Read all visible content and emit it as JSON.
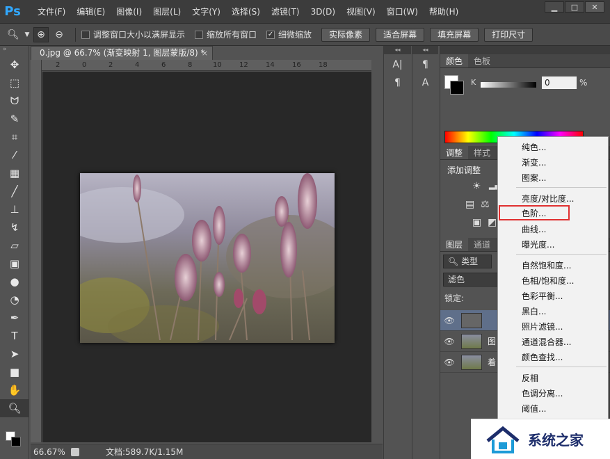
{
  "app": {
    "logo": "Ps"
  },
  "menu": [
    "文件(F)",
    "编辑(E)",
    "图像(I)",
    "图层(L)",
    "文字(Y)",
    "选择(S)",
    "滤镜(T)",
    "3D(D)",
    "视图(V)",
    "窗口(W)",
    "帮助(H)"
  ],
  "window_controls": {
    "minimize": "▁",
    "maximize": "□",
    "close": "✕"
  },
  "options": {
    "resize_windows": "调整窗口大小以满屏显示",
    "zoom_all": "缩放所有窗口",
    "scrubby_zoom": "细微缩放",
    "actual_pixels": "实际像素",
    "fit_screen": "适合屏幕",
    "fill_screen": "填充屏幕",
    "print_size": "打印尺寸",
    "scrubby_checked": "✓"
  },
  "document": {
    "tab_title": "0.jpg @ 66.7% (渐变映射 1, 图层蒙版/8) *",
    "tab_close": "×",
    "ruler_labels": [
      "2",
      "0",
      "2",
      "4",
      "6",
      "8",
      "10",
      "12",
      "14",
      "16",
      "18"
    ]
  },
  "status": {
    "zoom": "66.67%",
    "doc_info": "文档:589.7K/1.15M"
  },
  "color_panel": {
    "tabs": [
      "颜色",
      "色板"
    ],
    "k_label": "K",
    "k_value": "0",
    "k_unit": "%"
  },
  "adjust_panel": {
    "tabs": [
      "调整",
      "样式"
    ],
    "title": "添加调整"
  },
  "layers_panel": {
    "tabs": [
      "图层",
      "通道"
    ],
    "filter": "类型",
    "blend_mode": "滤色",
    "lock_label": "锁定:",
    "layers": [
      {
        "name": ""
      },
      {
        "name": "图"
      },
      {
        "name": "着"
      }
    ]
  },
  "dropdown": {
    "items": [
      "纯色...",
      "渐变...",
      "图案...",
      "亮度/对比度...",
      "色阶...",
      "曲线...",
      "曝光度...",
      "自然饱和度...",
      "色相/饱和度...",
      "色彩平衡...",
      "黑白...",
      "照片滤镜...",
      "通道混合器...",
      "颜色查找...",
      "反相",
      "色调分离...",
      "阈值..."
    ],
    "highlighted": "色阶..."
  },
  "watermark": {
    "text": "系统之家"
  }
}
